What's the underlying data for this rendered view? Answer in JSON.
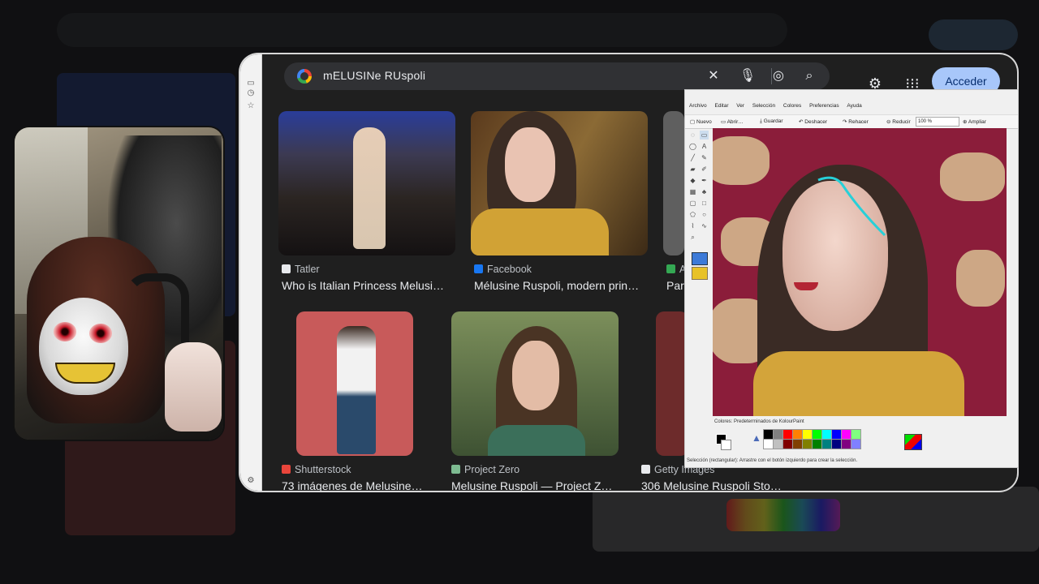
{
  "search": {
    "query": "mELUSINe RUspoli"
  },
  "header": {
    "signin_label": "Acceder"
  },
  "results": [
    {
      "source": "Tatler",
      "title": "Who is Italian Princess Melusi…",
      "favicon_color": "#e8eaed"
    },
    {
      "source": "Facebook",
      "title": "Mélusine Ruspoli, modern prin…",
      "favicon_color": "#1877f2"
    },
    {
      "source": "Ar",
      "title": "Pari",
      "favicon_color": "#34a853"
    },
    {
      "source": "Shutterstock",
      "title": "73 imágenes de Melusine…",
      "favicon_color": "#e9453b"
    },
    {
      "source": "Project Zero",
      "title": "Melusine Ruspoli — Project Z…",
      "favicon_color": "#7dbb91"
    },
    {
      "source": "Getty Images",
      "title": "306 Melusine Ruspoli Sto…",
      "favicon_color": "#e8eaed"
    }
  ],
  "paint": {
    "menu": [
      "Archivo",
      "Editar",
      "Ver",
      "Selección",
      "Colores",
      "Preferencias",
      "Ayuda"
    ],
    "toolbar": {
      "new": "Nuevo",
      "open": "Abrir…",
      "save": "Guardar",
      "undo": "Deshacer",
      "redo": "Rehacer",
      "shrink": "Reducir",
      "zoom": "100 %",
      "enlarge": "Ampliar"
    },
    "palette_label": "Colores: Predeterminados de KolourPaint",
    "status": "Selección (rectangular): Arrastre con el botón izquierdo para crear la selección.",
    "palette_colors": [
      "#000000",
      "#808080",
      "#ff0000",
      "#ff8000",
      "#ffff00",
      "#00ff00",
      "#00ffff",
      "#0000ff",
      "#ff00ff",
      "#80ff80",
      "#ffffff",
      "#c0c0c0",
      "#800000",
      "#804000",
      "#808000",
      "#008000",
      "#008080",
      "#000080",
      "#800080",
      "#8080ff"
    ]
  },
  "colors": {
    "accent": "#a8c7fa",
    "page_bg": "#1f1f1f",
    "search_bg": "#303134"
  }
}
